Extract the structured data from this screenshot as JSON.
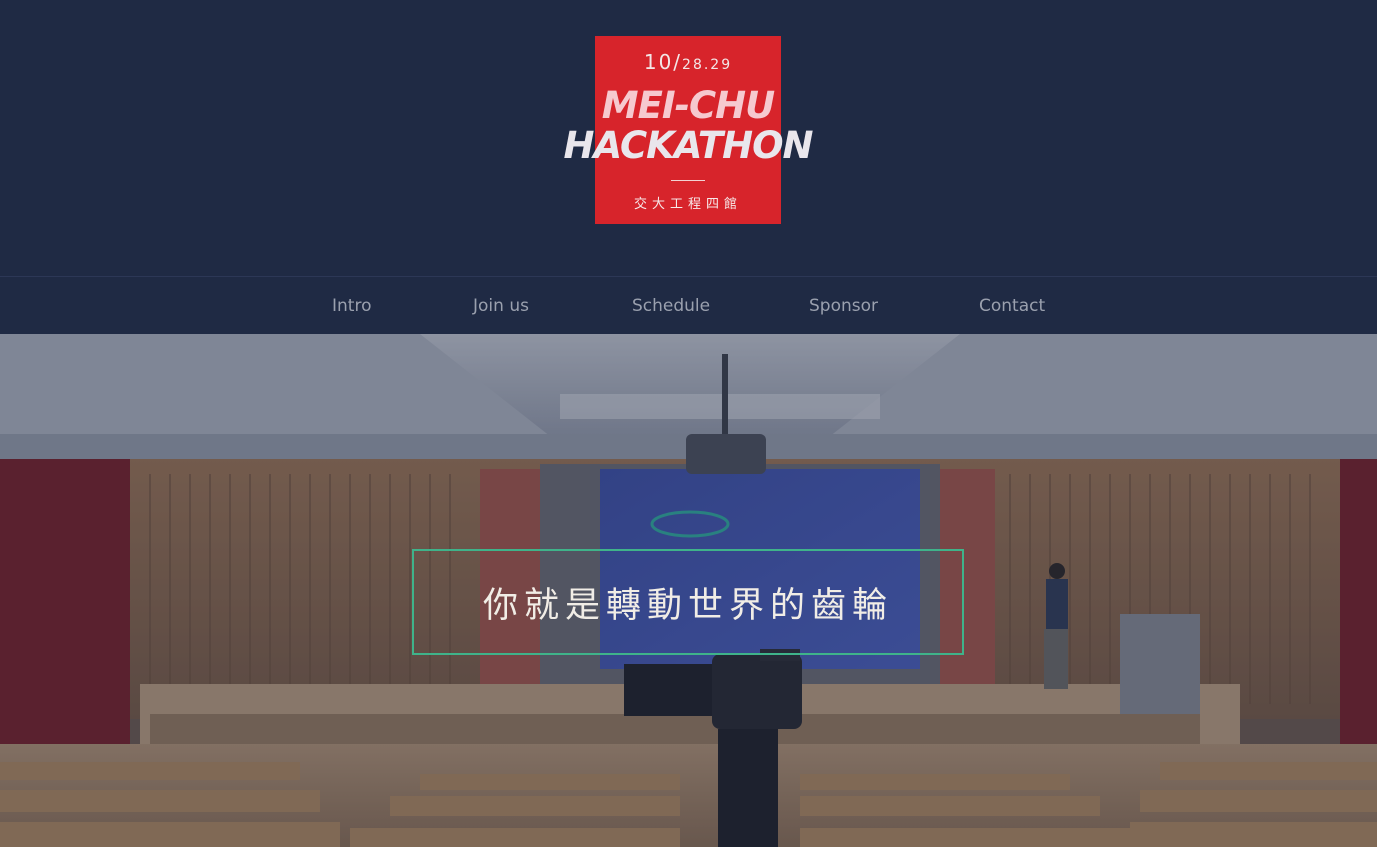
{
  "logo": {
    "date_big": "10/",
    "date_small": "28.29",
    "title_line1": "MEI-CHU",
    "title_line2": "HACKATHON",
    "venue": "交大工程四館",
    "box_color": "#d7242b"
  },
  "nav": {
    "items": [
      {
        "label": "Intro"
      },
      {
        "label": "Join us"
      },
      {
        "label": "Schedule"
      },
      {
        "label": "Sponsor"
      },
      {
        "label": "Contact"
      }
    ]
  },
  "hero": {
    "tagline": "你就是轉動世界的齒輪",
    "border_color": "#3fb38a"
  },
  "colors": {
    "background": "#1f2a44",
    "nav_text": "#9aa0ae"
  }
}
